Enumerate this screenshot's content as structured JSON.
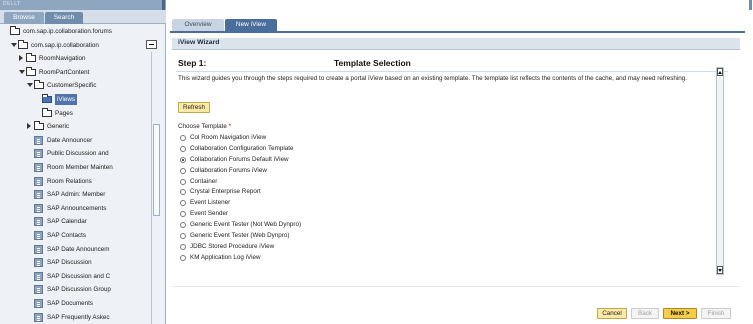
{
  "left_panel": {
    "top_label": "DELLT",
    "tabs": [
      {
        "label": "Browse"
      },
      {
        "label": "Search"
      }
    ],
    "tree": [
      {
        "label": "com.sap.ip.collaboration.forums",
        "indent": 0,
        "icon": "folder",
        "expander": "none"
      },
      {
        "label": "com.sap.ip.collaboration",
        "indent": 1,
        "icon": "folder",
        "expander": "down"
      },
      {
        "label": "RoomNavigation",
        "indent": 2,
        "icon": "folder",
        "expander": "right"
      },
      {
        "label": "RoomPartContent",
        "indent": 2,
        "icon": "folder",
        "expander": "down"
      },
      {
        "label": "CustomerSpecific",
        "indent": 3,
        "icon": "folder",
        "expander": "down"
      },
      {
        "label": "iViews",
        "indent": 4,
        "icon": "folder-selected",
        "expander": "none",
        "selected": true
      },
      {
        "label": "Pages",
        "indent": 4,
        "icon": "folder",
        "expander": "none"
      },
      {
        "label": "Generic",
        "indent": 3,
        "icon": "folder",
        "expander": "right"
      },
      {
        "label": "Date Announcer",
        "indent": 3,
        "icon": "doc",
        "expander": "none"
      },
      {
        "label": "Public Discussion and",
        "indent": 3,
        "icon": "doc",
        "expander": "none"
      },
      {
        "label": "Room Member Mainten",
        "indent": 3,
        "icon": "doc",
        "expander": "none"
      },
      {
        "label": "Room Relations",
        "indent": 3,
        "icon": "doc",
        "expander": "none"
      },
      {
        "label": "SAP Admin: Member",
        "indent": 3,
        "icon": "doc",
        "expander": "none"
      },
      {
        "label": "SAP Announcements",
        "indent": 3,
        "icon": "doc",
        "expander": "none"
      },
      {
        "label": "SAP Calendar",
        "indent": 3,
        "icon": "doc",
        "expander": "none"
      },
      {
        "label": "SAP Contacts",
        "indent": 3,
        "icon": "doc",
        "expander": "none"
      },
      {
        "label": "SAP Date Announcem",
        "indent": 3,
        "icon": "doc",
        "expander": "none"
      },
      {
        "label": "SAP Discussion",
        "indent": 3,
        "icon": "doc",
        "expander": "none"
      },
      {
        "label": "SAP Discussion and C",
        "indent": 3,
        "icon": "doc",
        "expander": "none"
      },
      {
        "label": "SAP Discussion Group",
        "indent": 3,
        "icon": "doc",
        "expander": "none"
      },
      {
        "label": "SAP Documents",
        "indent": 3,
        "icon": "doc",
        "expander": "none"
      },
      {
        "label": "SAP Frequently Askec",
        "indent": 3,
        "icon": "doc",
        "expander": "none"
      }
    ]
  },
  "main": {
    "tabs": [
      {
        "label": "Overview"
      },
      {
        "label": "New iView"
      }
    ],
    "header": "iView Wizard",
    "step": "Step 1:",
    "step_title": "Template Selection",
    "description": "This wizard guides you through the steps required to create a portal iView based on an existing template. The template list reflects the contents of the cache, and may need refreshing.",
    "refresh_label": "Refresh",
    "choose_label": "Choose Template",
    "required_mark": "*",
    "templates": [
      {
        "label": "Col Room Navigation iView",
        "selected": false
      },
      {
        "label": "Collaboration Configuration Template",
        "selected": false
      },
      {
        "label": "Collaboration Forums Default iView",
        "selected": true
      },
      {
        "label": "Collaboration Forums iView",
        "selected": false
      },
      {
        "label": "Container",
        "selected": false
      },
      {
        "label": "Crystal Enterprise Report",
        "selected": false
      },
      {
        "label": "Event Listener",
        "selected": false
      },
      {
        "label": "Event Sender",
        "selected": false
      },
      {
        "label": "Generic Event Tester (Not Web Dynpro)",
        "selected": false
      },
      {
        "label": "Generic Event Tester (Web Dynpro)",
        "selected": false
      },
      {
        "label": "JDBC Stored Procedure iView",
        "selected": false
      },
      {
        "label": "KM Application Log iView",
        "selected": false
      }
    ],
    "buttons": {
      "cancel": "Cancel",
      "back": "Back",
      "next": "Next >",
      "finish": "Finish"
    }
  },
  "colors": {
    "accent": "#4a6e9c",
    "nav_bg": "#eef1f5",
    "button_yellow": "#fbe9a6",
    "button_next": "#f6cd4a",
    "selection": "#4f74ad"
  }
}
